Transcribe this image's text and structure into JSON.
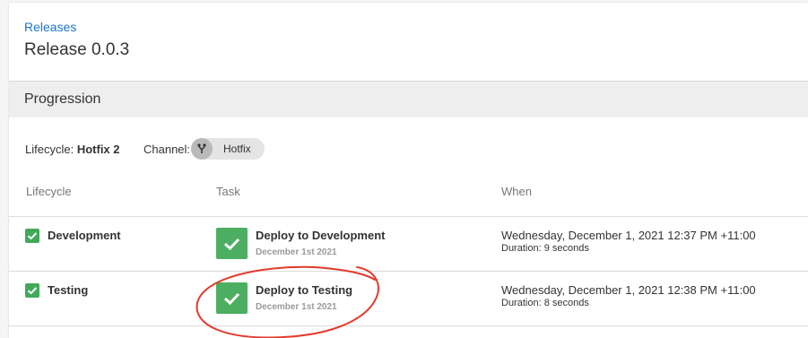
{
  "breadcrumb": {
    "label": "Releases"
  },
  "page_title": "Release 0.0.3",
  "section": {
    "title": "Progression"
  },
  "meta": {
    "lifecycle_label": "Lifecycle:",
    "lifecycle_value": "Hotfix 2",
    "channel_label": "Channel:",
    "channel_value": "Hotfix",
    "channel_icon": "branch-icon"
  },
  "table": {
    "headers": [
      "Lifecycle",
      "Task",
      "When"
    ],
    "rows": [
      {
        "lifecycle": "Development",
        "task_title": "Deploy to Development",
        "task_date": "December 1st 2021",
        "when": "Wednesday, December 1, 2021 12:37 PM +11:00",
        "duration": "Duration: 9 seconds"
      },
      {
        "lifecycle": "Testing",
        "task_title": "Deploy to Testing",
        "task_date": "December 1st 2021",
        "when": "Wednesday, December 1, 2021 12:38 PM +11:00",
        "duration": "Duration: 8 seconds"
      }
    ]
  },
  "colors": {
    "link": "#1a77ca",
    "success": "#4cae60",
    "annotation": "#e23b2e"
  }
}
